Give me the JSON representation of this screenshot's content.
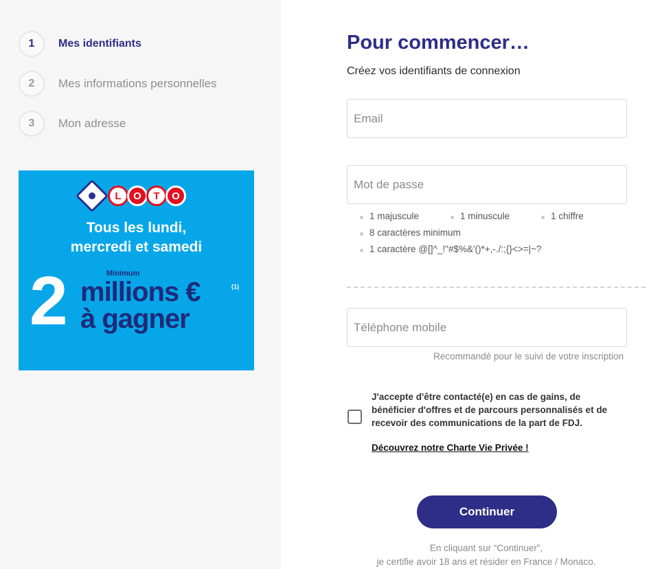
{
  "steps": [
    {
      "number": "1",
      "label": "Mes identifiants",
      "active": true
    },
    {
      "number": "2",
      "label": "Mes informations personnelles",
      "active": false
    },
    {
      "number": "3",
      "label": "Mon adresse",
      "active": false
    }
  ],
  "banner": {
    "logo_letters": [
      "L",
      "O",
      "T",
      "O"
    ],
    "tagline_line1": "Tous les lundi,",
    "tagline_line2": "mercredi et samedi",
    "minimum": "Minimum",
    "big_number": "2",
    "millions": "millions €",
    "footnote": "(1)",
    "gagner": "à gagner",
    "background_color": "#07a6e9"
  },
  "form": {
    "title": "Pour commencer…",
    "subtitle": "Créez vos identifiants de connexion",
    "email_placeholder": "Email",
    "password_placeholder": "Mot de passe",
    "password_rules": [
      "1 majuscule",
      "1 minuscule",
      "1 chiffre",
      "8 caractères minimum",
      "1 caractère @[]^_!\"#$%&'()*+,-./:;{}<>=|~?"
    ],
    "phone_placeholder": "Téléphone mobile",
    "phone_hint": "Recommandé pour le suivi de votre inscription",
    "consent_text": "J'accepte d'être contacté(e) en cas de gains, de bénéficier d'offres et de parcours personnalisés et de recevoir des communications de la part de FDJ.",
    "privacy_link": "Découvrez notre Charte Vie Privée !",
    "continue_label": "Continuer",
    "footer_line1": "En cliquant sur “Continuer”,",
    "footer_line2": "je certifie avoir 18 ans et résider en France / Monaco."
  },
  "colors": {
    "primary": "#2e2d87",
    "sidebar_bg": "#f6f6f6"
  }
}
